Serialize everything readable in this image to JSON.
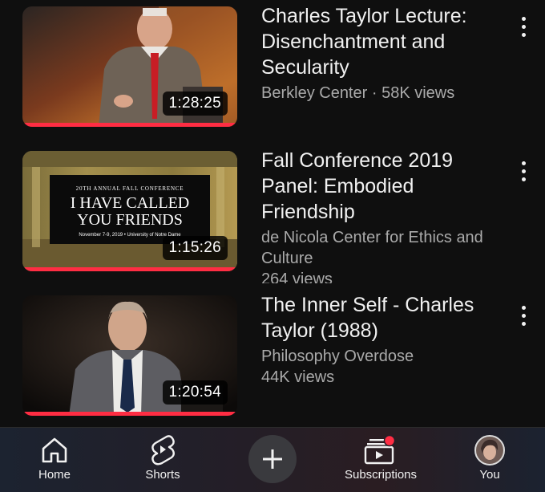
{
  "videos": [
    {
      "title": "Charles Taylor Lecture: Disenchantment and Secularity",
      "channel": "Berkley Center",
      "views": "58K views",
      "separator": "·",
      "duration": "1:28:25",
      "thumb_icon": "speaker-at-podium-thumbnail"
    },
    {
      "title": "Fall Conference 2019 Panel: Embodied Friendship",
      "channel": "de Nicola Center for Ethics and Culture",
      "views": "264 views",
      "duration": "1:15:26",
      "thumb_icon": "conference-banner-thumbnail",
      "thumb_overline": "20TH ANNUAL FALL CONFERENCE",
      "thumb_headline_1": "I HAVE CALLED",
      "thumb_headline_2": "YOU FRIENDS",
      "thumb_dates": "November 7-9, 2019 • University of Notre Dame"
    },
    {
      "title": "The Inner Self - Charles Taylor (1988)",
      "channel": "Philosophy Overdose",
      "views": "44K views",
      "duration": "1:20:54",
      "thumb_icon": "speaker-portrait-thumbnail"
    }
  ],
  "nav": {
    "home": "Home",
    "shorts": "Shorts",
    "subscriptions": "Subscriptions",
    "you": "You"
  },
  "colors": {
    "accent": "#ff2d43",
    "background": "#0f0f0f",
    "secondary_text": "#aaaaaa"
  }
}
